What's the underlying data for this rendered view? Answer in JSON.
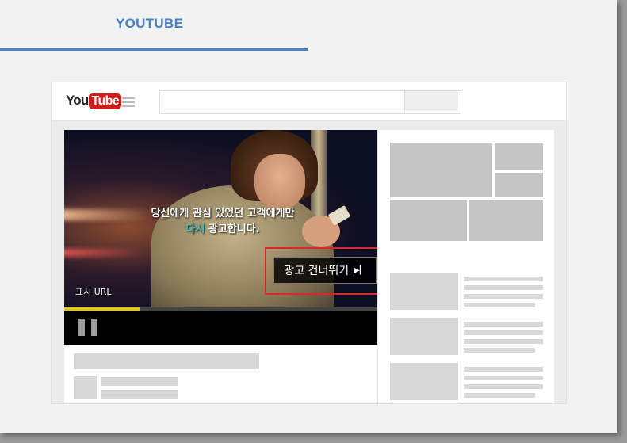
{
  "tab": {
    "label": "YOUTUBE",
    "accent": "#4a80c8"
  },
  "header": {
    "logo_you": "You",
    "logo_tube": "Tube",
    "search_placeholder": ""
  },
  "video": {
    "caption_line1": "당신에게 관심 있었던 고객에게만",
    "caption_line2_highlight": "다시",
    "caption_line2_rest": " 광고합니다.",
    "display_url": "표시 URL",
    "skip_label": "광고 건너뛰기",
    "skip_icon": "skip-next-icon",
    "progress": 0.24,
    "progress_color": "#e8c21e",
    "highlight_color": "#d32a2a"
  }
}
